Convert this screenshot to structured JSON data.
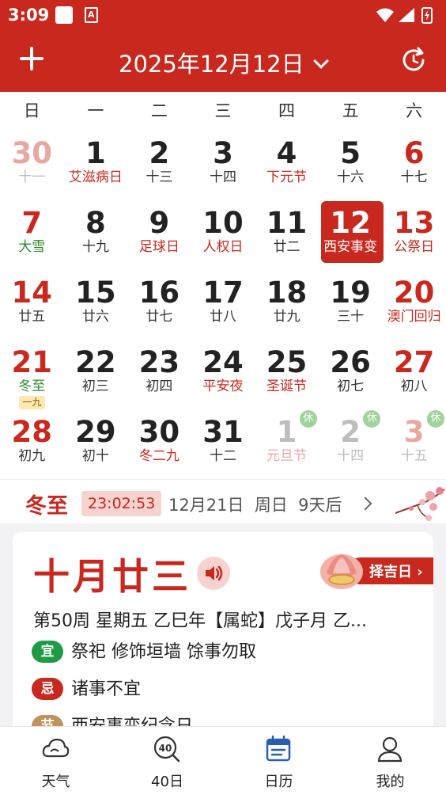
{
  "status_bar": {
    "time": "3:09",
    "sim_badge": "A"
  },
  "header": {
    "title": "2025年12月12日"
  },
  "weekdays": [
    "日",
    "一",
    "二",
    "三",
    "四",
    "五",
    "六"
  ],
  "calendar": {
    "rows": [
      [
        {
          "day": "30",
          "lunar": "十一"
        },
        {
          "day": "1",
          "lunar": "艾滋病日"
        },
        {
          "day": "2",
          "lunar": "十三"
        },
        {
          "day": "3",
          "lunar": "十四"
        },
        {
          "day": "4",
          "lunar": "下元节"
        },
        {
          "day": "5",
          "lunar": "十六"
        },
        {
          "day": "6",
          "lunar": "十七"
        }
      ],
      [
        {
          "day": "7",
          "lunar": "大雪"
        },
        {
          "day": "8",
          "lunar": "十九"
        },
        {
          "day": "9",
          "lunar": "足球日"
        },
        {
          "day": "10",
          "lunar": "人权日"
        },
        {
          "day": "11",
          "lunar": "廿二"
        },
        {
          "day": "12",
          "lunar": "西安事变"
        },
        {
          "day": "13",
          "lunar": "公祭日"
        }
      ],
      [
        {
          "day": "14",
          "lunar": "廿五"
        },
        {
          "day": "15",
          "lunar": "廿六"
        },
        {
          "day": "16",
          "lunar": "廿七"
        },
        {
          "day": "17",
          "lunar": "廿八"
        },
        {
          "day": "18",
          "lunar": "廿九"
        },
        {
          "day": "19",
          "lunar": "三十"
        },
        {
          "day": "20",
          "lunar": "澳门回归"
        }
      ],
      [
        {
          "day": "21",
          "lunar": "冬至",
          "tag": "一九"
        },
        {
          "day": "22",
          "lunar": "初三"
        },
        {
          "day": "23",
          "lunar": "初四"
        },
        {
          "day": "24",
          "lunar": "平安夜"
        },
        {
          "day": "25",
          "lunar": "圣诞节"
        },
        {
          "day": "26",
          "lunar": "初七"
        },
        {
          "day": "27",
          "lunar": "初八"
        }
      ],
      [
        {
          "day": "28",
          "lunar": "初九"
        },
        {
          "day": "29",
          "lunar": "初十"
        },
        {
          "day": "30",
          "lunar": "冬二九"
        },
        {
          "day": "31",
          "lunar": "十二"
        },
        {
          "day": "1",
          "lunar": "元旦节",
          "holiday": "休"
        },
        {
          "day": "2",
          "lunar": "十四",
          "holiday": "休"
        },
        {
          "day": "3",
          "lunar": "十五",
          "holiday": "休"
        }
      ]
    ]
  },
  "solar_term": {
    "name": "冬至",
    "countdown": "23:02:53",
    "date": "12月21日",
    "weekday": "周日",
    "days_left": "9天后"
  },
  "info_card": {
    "lunar_date": "十月廿三",
    "zeji_label": "择吉日",
    "details": "第50周 星期五 乙巳年【属蛇】戊子月 乙...",
    "yi_badge": "宜",
    "yi_text": "祭祀 修饰垣墙 馀事勿取",
    "ji_badge": "忌",
    "ji_text": "诸事不宜",
    "jie_badge": "节",
    "jie_text": "西安事变纪念日"
  },
  "bottom_nav": [
    {
      "label": "天气",
      "icon": "weather-icon"
    },
    {
      "label": "40日",
      "icon": "forecast-40-icon"
    },
    {
      "label": "日历",
      "icon": "calendar-icon",
      "active": true
    },
    {
      "label": "我的",
      "icon": "profile-icon"
    }
  ],
  "colors": {
    "primary_red": "#c8281e",
    "holiday_green": "#9fd39a",
    "solar_term_green": "#2f8a2f",
    "nav_active": "#2a5fb0"
  }
}
